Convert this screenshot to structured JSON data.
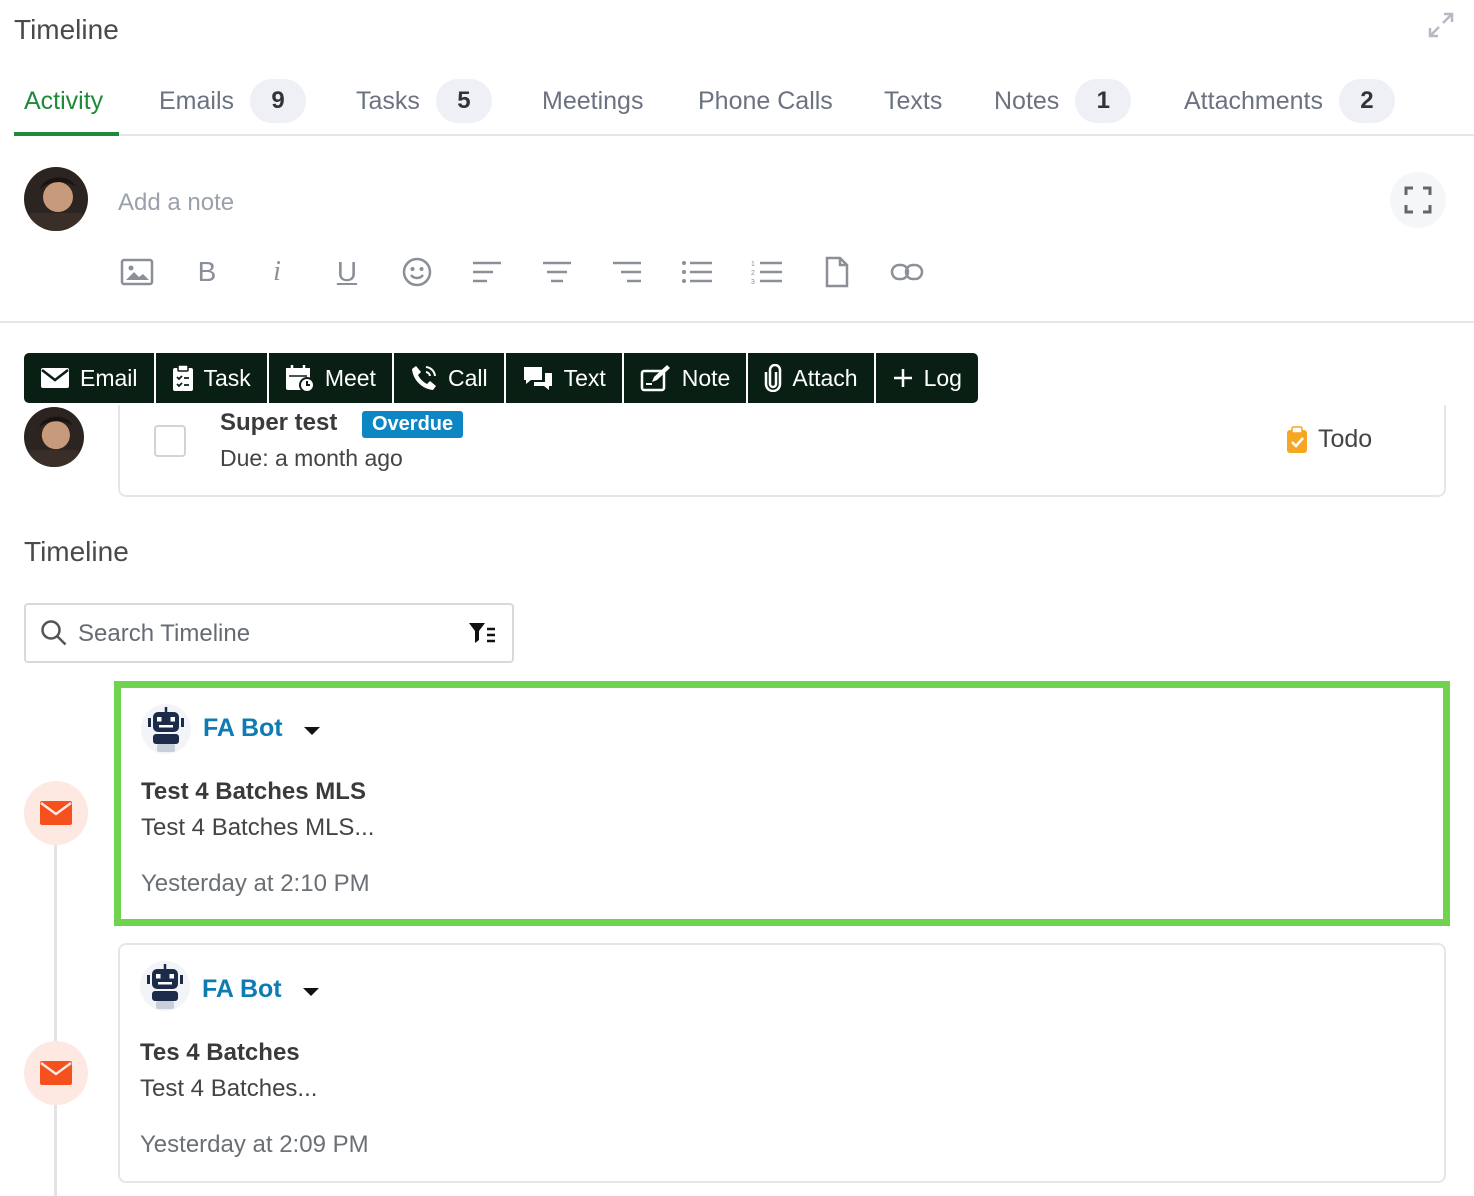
{
  "header": {
    "title": "Timeline"
  },
  "tabs": [
    {
      "label": "Activity",
      "count": ""
    },
    {
      "label": "Emails",
      "count": "9"
    },
    {
      "label": "Tasks",
      "count": "5"
    },
    {
      "label": "Meetings",
      "count": ""
    },
    {
      "label": "Phone Calls",
      "count": ""
    },
    {
      "label": "Texts",
      "count": ""
    },
    {
      "label": "Notes",
      "count": "1"
    },
    {
      "label": "Attachments",
      "count": "2"
    }
  ],
  "composer": {
    "placeholder": "Add a note",
    "toolbar_icons": [
      "image-icon",
      "bold-icon",
      "italic-icon",
      "underline-icon",
      "emoji-icon",
      "align-left-icon",
      "align-center-icon",
      "align-right-icon",
      "bullet-list-icon",
      "numbered-list-icon",
      "file-icon",
      "link-icon"
    ],
    "bold_glyph": "B",
    "italic_glyph": "i",
    "underline_glyph": "U"
  },
  "actions": [
    {
      "label": "Email",
      "icon": "envelope-icon"
    },
    {
      "label": "Task",
      "icon": "clipboard-icon"
    },
    {
      "label": "Meet",
      "icon": "calendar-icon"
    },
    {
      "label": "Call",
      "icon": "phone-icon"
    },
    {
      "label": "Text",
      "icon": "chat-icon"
    },
    {
      "label": "Note",
      "icon": "pencil-icon"
    },
    {
      "label": "Attach",
      "icon": "paperclip-icon"
    },
    {
      "label": "Log",
      "icon": "plus-icon"
    }
  ],
  "task": {
    "title": "Super test",
    "badge": "Overdue",
    "due": "Due: a month ago",
    "status": "Todo"
  },
  "timeline": {
    "title": "Timeline",
    "search_placeholder": "Search Timeline",
    "entries": [
      {
        "author": "FA Bot",
        "subject": "Test 4 Batches MLS",
        "preview": "Test 4 Batches MLS...",
        "time": "Yesterday at 2:10 PM",
        "highlighted": true
      },
      {
        "author": "FA Bot",
        "subject": "Tes 4 Batches",
        "preview": "Test 4 Batches...",
        "time": "Yesterday at 2:09 PM",
        "highlighted": false
      }
    ]
  },
  "colors": {
    "accent_green": "#1f8a3b",
    "action_bar_bg": "#0a1f14",
    "overdue_badge": "#0e86c4",
    "bot_name": "#0e7bb3",
    "email_icon": "#f4511e",
    "highlight_border": "#6fd34f",
    "todo_icon": "#f5a623"
  }
}
